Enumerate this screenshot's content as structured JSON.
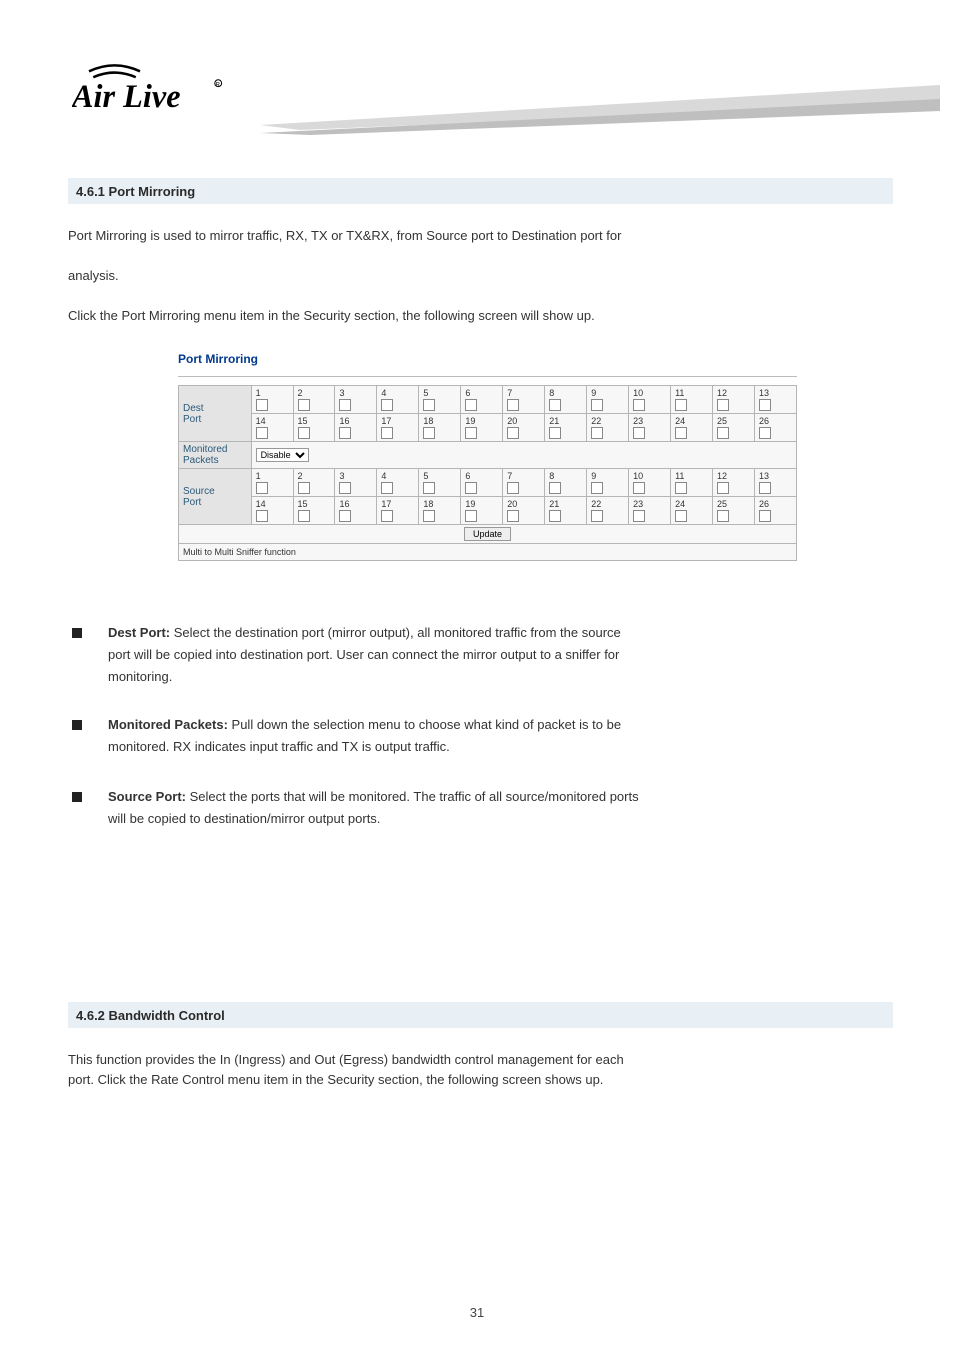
{
  "logo_alt": "Air Live",
  "section1_title": "4.6.1 Port Mirroring",
  "intro": {
    "l1": "Port Mirroring is used to mirror traffic, RX, TX or TX&RX, from Source port to Destination port for",
    "l2": "analysis.",
    "l3": "Click the Port Mirroring menu item in the Security section, the following screen will show up."
  },
  "shot": {
    "title": "Port Mirroring",
    "row_labels": {
      "dest": "Dest\nPort",
      "monitored": "Monitored\nPackets",
      "source": "Source\nPort"
    },
    "ports_row1": [
      "1",
      "2",
      "3",
      "4",
      "5",
      "6",
      "7",
      "8",
      "9",
      "10",
      "11",
      "12",
      "13"
    ],
    "ports_row2": [
      "14",
      "15",
      "16",
      "17",
      "18",
      "19",
      "20",
      "21",
      "22",
      "23",
      "24",
      "25",
      "26"
    ],
    "monitored_value": "Disable",
    "update_label": "Update",
    "footnote": "Multi to Multi Sniffer function"
  },
  "bullets": {
    "b1_label": "Dest Port:",
    "b1_rest": " Select the destination port (mirror output), all monitored traffic from the source",
    "b1_l2": "port will be copied into destination port. User can connect the mirror output to a sniffer for",
    "b1_l3": "monitoring.",
    "b2_label": "Monitored Packets:",
    "b2_rest": " Pull down the selection menu to choose what kind of packet is to be",
    "b2_l2": "monitored. RX indicates input traffic and TX is output traffic.",
    "b3_label": "Source Port:",
    "b3_rest": " Select the ports that will be monitored. The traffic of all source/monitored ports",
    "b3_l2": "will be copied to destination/mirror output ports."
  },
  "section2_title": "4.6.2 Bandwidth Control",
  "intro2": {
    "l1": "This function provides the In (Ingress) and Out (Egress) bandwidth control management for each",
    "l2": "port. Click the Rate Control menu item in the Security section, the following screen shows up."
  },
  "footer": "31"
}
